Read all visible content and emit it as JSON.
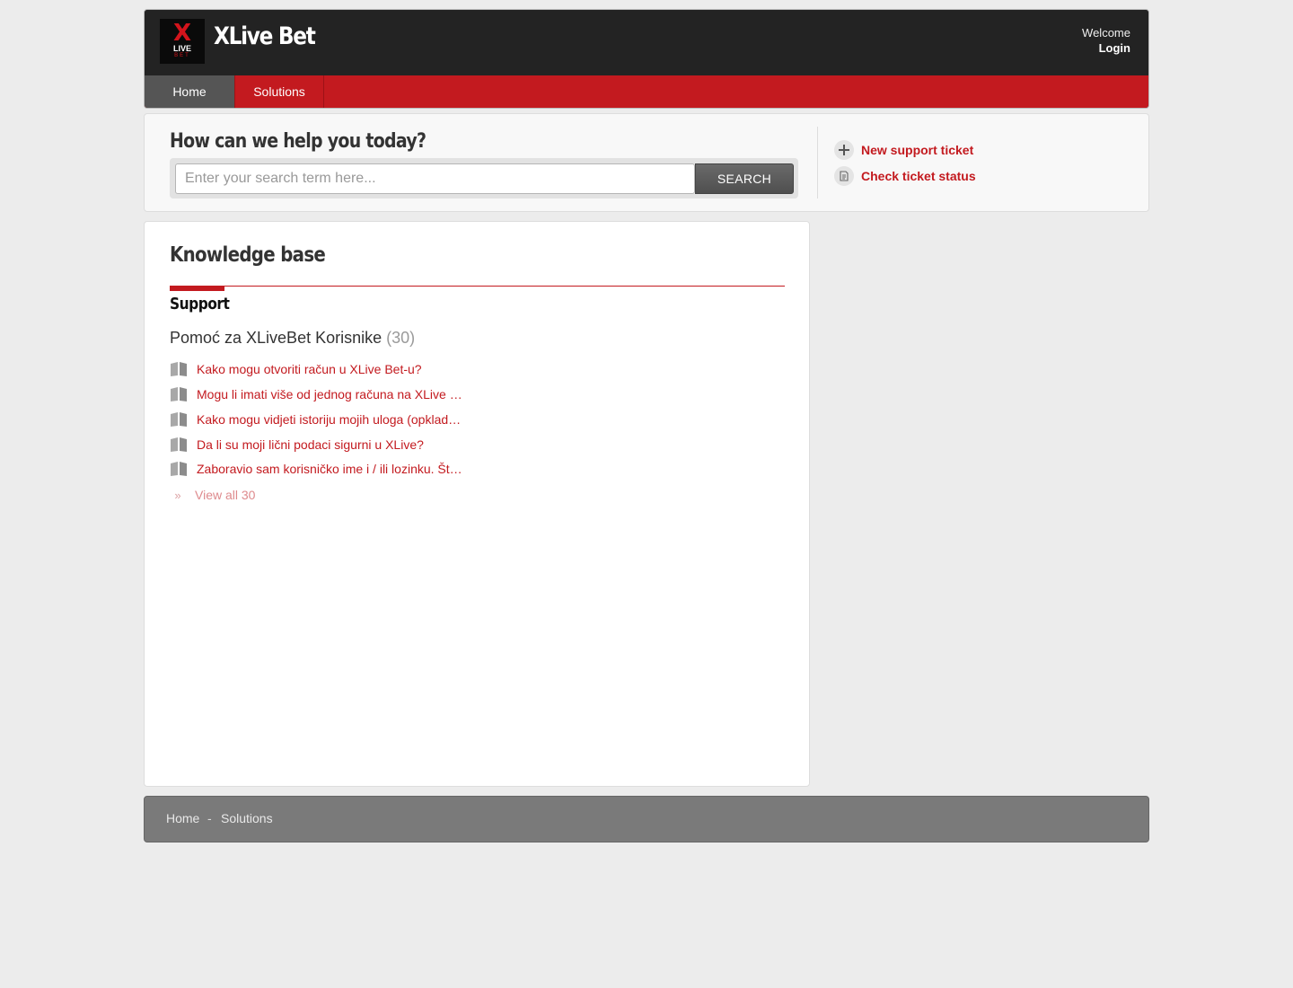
{
  "header": {
    "logo": {
      "mark": "X",
      "word": "LIVE",
      "sub": "BET"
    },
    "site_title": "XLive Bet",
    "welcome": "Welcome",
    "login": "Login"
  },
  "nav": {
    "tabs": [
      {
        "label": "Home",
        "active": true
      },
      {
        "label": "Solutions",
        "active": false
      }
    ]
  },
  "search": {
    "heading": "How can we help you today?",
    "placeholder": "Enter your search term here...",
    "button": "SEARCH"
  },
  "sidebar": {
    "new_ticket": "New support ticket",
    "check_status": "Check ticket status"
  },
  "kb": {
    "heading": "Knowledge base",
    "category": "Support",
    "folder": {
      "title": "Pomoć za XLiveBet Korisnike",
      "count": "(30)"
    },
    "articles": [
      "Kako mogu otvoriti račun u XLive Bet-u?",
      "Mogu li imati više od jednog računa na XLive Bet-u?",
      "Kako mogu vidjeti istoriju mojih uloga (opklada)?",
      "Da li su moji lični podaci sigurni u XLive?",
      "Zaboravio sam korisničko ime i / ili lozinku. Šta da radim?"
    ],
    "view_all": "View all 30"
  },
  "footer": {
    "home": "Home",
    "separator": "-",
    "solutions": "Solutions"
  },
  "colors": {
    "brand_red": "#c31a1f",
    "header_dark": "#232323",
    "footer_gray": "#7a7a7a"
  }
}
